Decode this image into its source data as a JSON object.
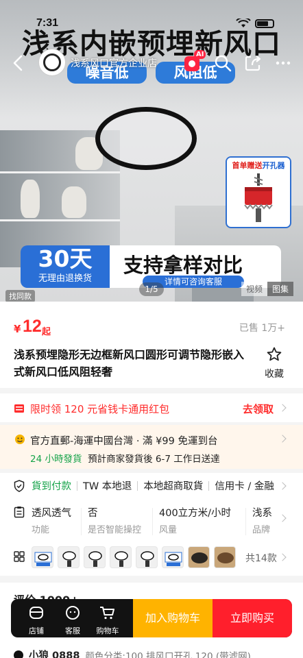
{
  "status_bar": {
    "time": "7:31"
  },
  "hero": {
    "title": "浅系内嵌预埋新风口",
    "tags": [
      "噪音低",
      "风阻低"
    ],
    "store_name": "浅系风口官方企业店",
    "ai_badge": "AI",
    "promo": {
      "prefix": "首单赠送",
      "suffix": "开孔器"
    },
    "banner_big": "30天",
    "banner_small": "无理由退换货",
    "banner_main": "支持拿样对比",
    "banner_sub": "详情可咨询客服",
    "find_label": "找同款",
    "image_counter": "1/5",
    "media_tabs": [
      "视频",
      "图集"
    ]
  },
  "product": {
    "price_symbol": "¥",
    "price": "12",
    "price_suffix": "起",
    "sold": "已售 1万+",
    "title": "浅系预埋隐形无边框新风口圆形可调节隐形嵌入式新风口低风阻轻奢",
    "favorite_label": "收藏"
  },
  "coupon": {
    "text": "限时领 120 元省钱卡通用红包",
    "cta": "去领取"
  },
  "shipping": {
    "line1": "官方直郵-海運中國台灣 · 滿 ¥99 免運到台",
    "badge": "24 小時發貨",
    "line2": "預計商家發貨後 6-7 工作日送達"
  },
  "services": [
    "貨到付款",
    "TW 本地退",
    "本地超商取貨",
    "信用卡 / 金融"
  ],
  "attributes": [
    {
      "value": "透风透气",
      "key": "功能"
    },
    {
      "value": "否",
      "key": "是否智能操控"
    },
    {
      "value": "400立方米/小时",
      "key": "风量"
    },
    {
      "value": "浅系",
      "key": "品牌"
    }
  ],
  "sku": {
    "count_label": "共14款"
  },
  "reviews": {
    "head": "评价 1000+",
    "user": "小狼 0888",
    "spec": "颜色分类:100 排风口开孔 120 (带滤网)"
  },
  "bottom_bar": {
    "items": [
      "店铺",
      "客服",
      "购物车"
    ],
    "add_to_cart": "加入购物车",
    "buy_now": "立即购买"
  },
  "colors": {
    "price_red": "#ff2c2c",
    "accent_blue": "#2a6fd6",
    "cart_yellow": "#ffb300",
    "buy_red": "#ff1f2c",
    "success_green": "#16a34a"
  }
}
